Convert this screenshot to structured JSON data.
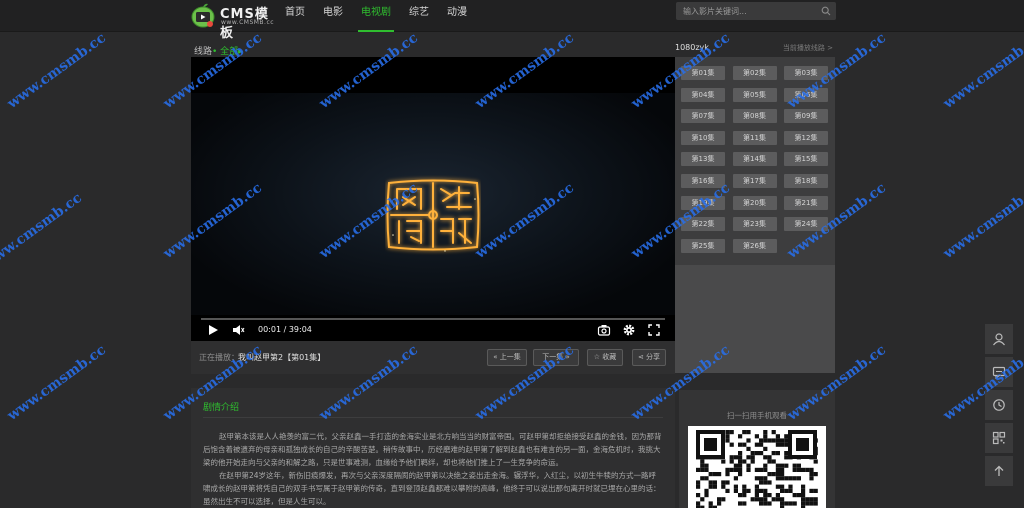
{
  "header": {
    "logo_title": "CMS模板",
    "logo_sub": "www.CMSMB.cc",
    "nav": [
      {
        "label": "首页",
        "active": false
      },
      {
        "label": "电影",
        "active": false
      },
      {
        "label": "电视剧",
        "active": true
      },
      {
        "label": "综艺",
        "active": false
      },
      {
        "label": "动漫",
        "active": false
      }
    ],
    "search_placeholder": "输入影片关键词..."
  },
  "player": {
    "line_prefix": "线路",
    "line_highlight": "• 全部▸",
    "time": "00:01 / 39:04",
    "progress": 0.0
  },
  "now_playing": {
    "label": "正在播放：",
    "title": "我叫赵甲第2【第01集】",
    "buttons": {
      "prev": "« 上一集",
      "next": "下一集 »",
      "fav": "收藏",
      "share": "分享"
    }
  },
  "episodes": {
    "source": "1080zyk",
    "hint": "当前播放线路 >",
    "items": [
      "第01集",
      "第02集",
      "第03集",
      "第04集",
      "第05集",
      "第06集",
      "第07集",
      "第08集",
      "第09集",
      "第10集",
      "第11集",
      "第12集",
      "第13集",
      "第14集",
      "第15集",
      "第16集",
      "第17集",
      "第18集",
      "第19集",
      "第20集",
      "第21集",
      "第22集",
      "第23集",
      "第24集",
      "第25集",
      "第26集"
    ]
  },
  "intro": {
    "title": "剧情介绍",
    "paragraphs": [
      "赵甲第本该是人人艳羡的富二代，父亲赵鑫一手打造的金海实业是北方响当当的财富帝国。可赵甲第却拒绝接受赵鑫的金钱，因为那背后饱含着被遗弃的母亲和孤独成长的自己的辛酸苦楚。稍传故事中，历经磨难的赵甲第了解到赵鑫也有难言的另一面，金海危机时，我挑大梁的他开始走向与父亲的和解之路，只是世事难测，血缘给予他们羁绊，却也将他们推上了一生竞争的命运。",
      "在赵甲第24岁这年，新伤旧痕爆发，再次与父亲深度隔阂的赵甲第以决绝之姿出走金海。辗浮华，入红尘，以初生牛犊的方式一路呼啸成长的赵甲第将凭自己的双手书写属于赵甲第的传奇，直到登顶赵鑫都难以攀附的高峰，他终于可以说出那句离开时就已埋在心里的话：虽然出生不可以选择，但是人生可以。"
    ]
  },
  "qr": {
    "label": "扫一扫用手机观看"
  },
  "watermark": "www.cmsmb.cc",
  "colors": {
    "accent": "#2fbe2f",
    "background": "#2a2a2b",
    "watermark": "#286eeb",
    "seal_glow": "#f5a623"
  }
}
